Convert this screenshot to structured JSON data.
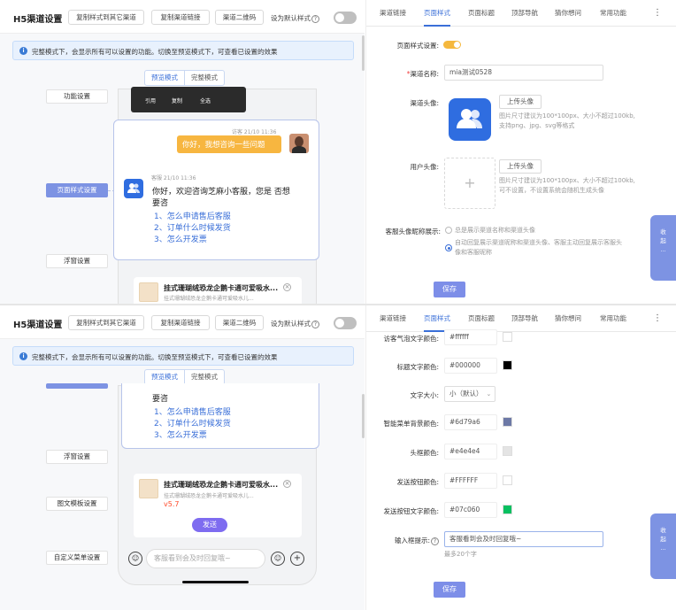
{
  "app": {
    "title": "H5渠道设置"
  },
  "toolbar": {
    "copy_to_other": "复制样式到其它渠道",
    "copy_link": "复制渠道链接",
    "qr_code": "渠道二维码",
    "set_default": "设为默认样式",
    "help": "?"
  },
  "notice": {
    "text": "完整模式下，会显示所有可以设置的功能。切换至预览模式下，可查看已设置的效果"
  },
  "mode_tabs": {
    "preview": "预览模式",
    "full": "完整模式"
  },
  "sidebar": {
    "function_settings": "功能设置",
    "page_style_settings": "页面样式设置",
    "float_settings": "浮窗设置",
    "rich_text_settings": "图文模板设置",
    "custom_menu_settings": "自定义菜单设置"
  },
  "tooltip": {
    "quote": "引用",
    "copy": "复制",
    "select_all": "全选"
  },
  "chat": {
    "visitor_time": "访客 21/10 11:36",
    "visitor_msg": "你好，我想咨询一些问题",
    "agent_time": "客服 21/10 11:36",
    "agent_msg_line1": "你好，欢迎咨询芝麻小客服，您是 否想",
    "agent_msg_line2": "要咨",
    "agent_msg_line2b": "要咨",
    "q1": "1、怎么申请售后客服",
    "q2": "2、订单什么时候发货",
    "q3": "3、怎么开发票",
    "product_title": "挂式珊瑚绒恐龙企鹅卡通可爱吸水...",
    "product_desc": "挂式珊瑚绒恐龙企鹅卡通可爱吸水儿...",
    "product_price": "v5.7",
    "send": "发送",
    "input_placeholder": "客服看到会及时回复哦~"
  },
  "tabs": {
    "channel_link": "渠道链接",
    "page_style": "页面样式",
    "page_title": "页面标题",
    "top_nav": "顶部导航",
    "guess_ask": "猜你想问",
    "common_functions": "常用功能",
    "more": "⋮"
  },
  "form": {
    "page_style_label": "页面样式设置:",
    "channel_name_label": "渠道名称:",
    "channel_name_value": "mia测试0528",
    "channel_avatar_label": "渠道头像:",
    "upload_avatar": "上传头像",
    "avatar_hint_1": "图片尺寸建议为100*100px、大小不超过100kb,",
    "avatar_hint_2": "支持png、jpg、svg等格式",
    "user_avatar_label": "用户头像:",
    "user_avatar_hint_1": "图片尺寸建议为100*100px、大小不超过100kb,",
    "user_avatar_hint_2": "可不设置，不设置系统会随机生成头像",
    "display_label": "客服头像昵称展示:",
    "display_option_1": "总是展示渠道名称和渠道头像",
    "display_option_2a": "自动回复展示渠道昵称和渠道头像、客服主动回复展示客服头",
    "display_option_2b": "像和客服昵称",
    "save": "保存"
  },
  "colors_form": {
    "visitor_bubble_text_label": "访客气泡文字颜色:",
    "visitor_bubble_text_value": "#ffffff",
    "title_text_label": "标题文字颜色:",
    "title_text_value": "#000000",
    "font_size_label": "文字大小:",
    "font_size_value": "小（默认）",
    "smart_menu_bg_label": "智能菜单背景颜色:",
    "smart_menu_bg_value": "#6d79a6",
    "input_bg_label": "头框颜色:",
    "input_bg_value": "#e4e4e4",
    "send_btn_label": "发送按钮颜色:",
    "send_btn_value": "#FFFFFF",
    "send_btn_text_label": "发送按钮文字颜色:",
    "send_btn_text_value": "#07c060",
    "input_hint_label": "输入框提示:",
    "input_hint_value": "客服看到会及时回复哦~",
    "input_hint_limit": "最多20个字",
    "save": "保存"
  },
  "float_side": {
    "text_1": "收",
    "text_2": "起",
    "text_3": "..."
  },
  "swatches": {
    "white": "#ffffff",
    "black": "#000000",
    "slate": "#6d79a6",
    "gray": "#e4e4e4",
    "green": "#07c060",
    "accent": "#3a6fd8"
  }
}
